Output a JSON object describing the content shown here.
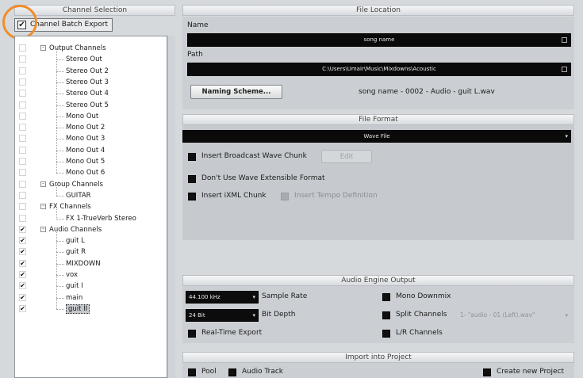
{
  "channel_selection": {
    "header": "Channel Selection",
    "batch_export_label": "Channel Batch Export",
    "batch_export_checked": true,
    "tree": [
      {
        "label": "Output Channels",
        "level": 0,
        "expander": "-",
        "checked": false
      },
      {
        "label": "Stereo Out",
        "level": 1,
        "checked": false
      },
      {
        "label": "Stereo Out 2",
        "level": 1,
        "checked": false
      },
      {
        "label": "Stereo Out 3",
        "level": 1,
        "checked": false
      },
      {
        "label": "Stereo Out 4",
        "level": 1,
        "checked": false
      },
      {
        "label": "Stereo Out 5",
        "level": 1,
        "checked": false
      },
      {
        "label": "Mono Out",
        "level": 1,
        "checked": false
      },
      {
        "label": "Mono Out 2",
        "level": 1,
        "checked": false
      },
      {
        "label": "Mono Out 3",
        "level": 1,
        "checked": false
      },
      {
        "label": "Mono Out 4",
        "level": 1,
        "checked": false
      },
      {
        "label": "Mono Out 5",
        "level": 1,
        "checked": false
      },
      {
        "label": "Mono Out 6",
        "level": 1,
        "checked": false
      },
      {
        "label": "Group Channels",
        "level": 0,
        "expander": "-",
        "checked": false
      },
      {
        "label": "GUITAR",
        "level": 1,
        "checked": false
      },
      {
        "label": "FX Channels",
        "level": 0,
        "expander": "-",
        "checked": false
      },
      {
        "label": "FX 1-TrueVerb Stereo",
        "level": 1,
        "checked": false
      },
      {
        "label": "Audio Channels",
        "level": 0,
        "expander": "-",
        "checked": true
      },
      {
        "label": "guit L",
        "level": 1,
        "checked": true
      },
      {
        "label": "guit R",
        "level": 1,
        "checked": true
      },
      {
        "label": "MIXDOWN",
        "level": 1,
        "checked": true
      },
      {
        "label": "vox",
        "level": 1,
        "checked": true
      },
      {
        "label": "guit I",
        "level": 1,
        "checked": true
      },
      {
        "label": "main",
        "level": 1,
        "checked": true
      },
      {
        "label": "guit II",
        "level": 1,
        "checked": true,
        "selected": true
      }
    ]
  },
  "file_location": {
    "header": "File Location",
    "name_label": "Name",
    "name_value": "song name",
    "path_label": "Path",
    "path_value": "C:\\Users\\Umair\\Music\\Mixdowns\\Acoustic",
    "naming_scheme_button": "Naming Scheme...",
    "naming_preview": "song name - 0002 - Audio - guit L.wav"
  },
  "file_format": {
    "header": "File Format",
    "format_value": "Wave File",
    "insert_broadcast_label": "Insert Broadcast Wave Chunk",
    "edit_button": "Edit",
    "dont_use_extensible_label": "Don't Use Wave Extensible Format",
    "insert_ixml_label": "Insert iXML Chunk",
    "insert_tempo_label": "Insert Tempo Definition"
  },
  "audio_engine_output": {
    "header": "Audio Engine Output",
    "sample_rate_value": "44.100 kHz",
    "sample_rate_label": "Sample Rate",
    "bit_depth_value": "24 Bit",
    "bit_depth_label": "Bit Depth",
    "realtime_export_label": "Real-Time Export",
    "mono_downmix_label": "Mono Downmix",
    "split_channels_label": "Split Channels",
    "split_channels_value": "1- \"audio - 01 (Left).wav\"",
    "lr_channels_label": "L/R Channels"
  },
  "import_into_project": {
    "header": "Import into Project",
    "pool_label": "Pool",
    "audio_track_label": "Audio Track",
    "create_new_project_label": "Create new Project"
  },
  "colors": {
    "highlight_circle": "#f08c2a",
    "background": "#d6d9dc",
    "dark_field": "#0a0a0a"
  }
}
